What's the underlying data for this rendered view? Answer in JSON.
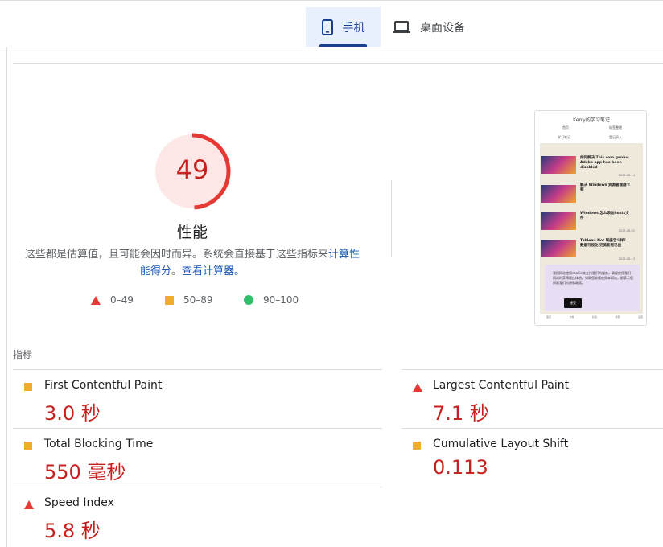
{
  "tabs": [
    {
      "label": "手机",
      "icon": "phone-icon",
      "active": true
    },
    {
      "label": "桌面设备",
      "icon": "laptop-icon",
      "active": false
    }
  ],
  "score": {
    "value": "49",
    "fraction": 0.49,
    "color": "#c5221f"
  },
  "category": {
    "title": "性能",
    "desc_prefix": "这些都是估算值，且可能会因时而异。系统会直接基于这些指标来",
    "desc_link1": "计算性能得分",
    "desc_mid": "。",
    "desc_link2": "查看计算器。"
  },
  "legend": {
    "fail": "0–49",
    "average": "50–89",
    "pass": "90–100"
  },
  "preview": {
    "site_title": "Kerry的学习笔记",
    "nav": [
      "首页",
      "标签整理",
      "学习笔记",
      "登记录入"
    ],
    "posts": [
      {
        "title": "如何解决 This com.genius Adobe app has been disabled",
        "date": "2023-08-14"
      },
      {
        "title": "解决 Windows 资源管理器卡顿",
        "date": ""
      },
      {
        "title": "Windows 怎么添加hosts文件",
        "date": "2023-08-03"
      },
      {
        "title": "Tableau Not 联接怎么样？| 数据可视化 完美新版已出",
        "date": "2023-08-13"
      }
    ],
    "cookie_text": "我们网站使用cookie来支持我们的服务，确保使用我们网站时获得最佳体验。如果您继续使用本网站，即表示您同意我们的隐私政策。",
    "cookie_btn": "接受",
    "footer": [
      "首页",
      "分类",
      "标签",
      "搜索",
      "设置"
    ]
  },
  "metrics_title": "指标",
  "metrics": [
    {
      "name": "First Contentful Paint",
      "value": "3.0 秒",
      "rating": "average"
    },
    {
      "name": "Largest Contentful Paint",
      "value": "7.1 秒",
      "rating": "fail"
    },
    {
      "name": "Total Blocking Time",
      "value": "550 毫秒",
      "rating": "average"
    },
    {
      "name": "Cumulative Layout Shift",
      "value": "0.113",
      "rating": "average"
    },
    {
      "name": "Speed Index",
      "value": "5.8 秒",
      "rating": "fail"
    }
  ],
  "colors": {
    "fail": "#e53935",
    "average": "#f0ad2d",
    "pass": "#2fbf68",
    "link": "#1a56b4"
  }
}
